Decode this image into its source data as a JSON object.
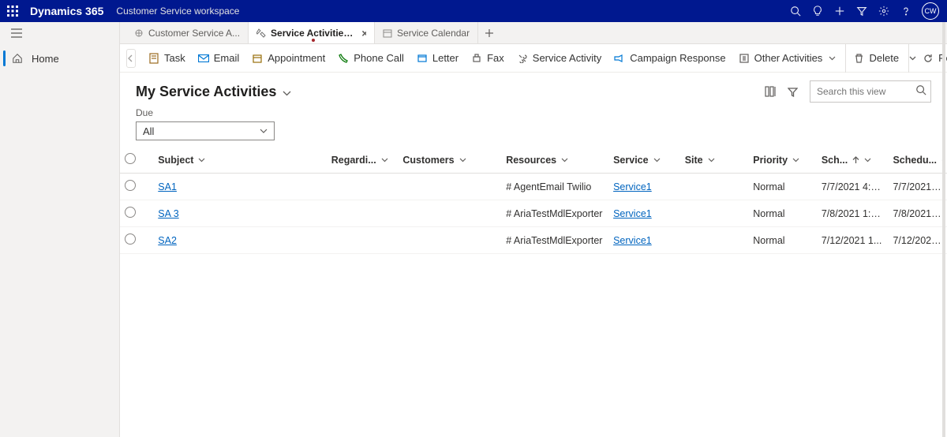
{
  "topbar": {
    "app_name": "Dynamics 365",
    "workspace": "Customer Service workspace",
    "avatar_initials": "CW"
  },
  "sidebar": {
    "home": "Home"
  },
  "tabs": [
    {
      "label": "Customer Service A...",
      "active": false
    },
    {
      "label": "Service Activities My Ser...",
      "active": true
    },
    {
      "label": "Service Calendar",
      "active": false
    }
  ],
  "commands": {
    "task": "Task",
    "email": "Email",
    "appointment": "Appointment",
    "phone": "Phone Call",
    "letter": "Letter",
    "fax": "Fax",
    "service_activity": "Service Activity",
    "campaign": "Campaign Response",
    "other": "Other Activities",
    "delete": "Delete",
    "refresh": "Refresh"
  },
  "view": {
    "title": "My Service Activities",
    "search_placeholder": "Search this view",
    "filter_label": "Due",
    "filter_value": "All"
  },
  "columns": {
    "subject": "Subject",
    "regarding": "Regardi...",
    "customers": "Customers",
    "resources": "Resources",
    "service": "Service",
    "site": "Site",
    "priority": "Priority",
    "scheduled_start": "Sch...",
    "scheduled_end": "Schedu..."
  },
  "rows": [
    {
      "subject": "SA1",
      "resources": "# AgentEmail Twilio",
      "service": "Service1",
      "priority": "Normal",
      "sched_start": "7/7/2021 4:4...",
      "sched_end": "7/7/2021 5:4..."
    },
    {
      "subject": "SA 3",
      "resources": "# AriaTestMdlExporter",
      "service": "Service1",
      "priority": "Normal",
      "sched_start": "7/8/2021 1:3...",
      "sched_end": "7/8/2021 2:3..."
    },
    {
      "subject": "SA2",
      "resources": "# AriaTestMdlExporter",
      "service": "Service1",
      "priority": "Normal",
      "sched_start": "7/12/2021 1...",
      "sched_end": "7/12/2021 1..."
    }
  ]
}
